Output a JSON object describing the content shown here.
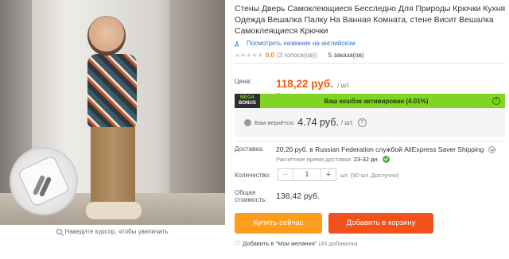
{
  "gallery": {
    "zoom_hint": "Наведите курсор, чтобы увеличить"
  },
  "product": {
    "title": "Стены Дверь Самоклеющиеся Бесследно Для Природы Крючки Кухня Одежда Вешалка Палку На Ванная Комната, стене Висит Вешалка Самоклеящиеся Крючки",
    "translate_link": "Посмотреть название на английском",
    "rating": {
      "stars": "★★★★★",
      "score": "0.0",
      "votes": "(3 голоса(ов))",
      "orders": "5 заказа(ов)"
    }
  },
  "pricing": {
    "price_label": "Цена:",
    "price": "118,22 руб.",
    "per_unit": "/ шт.",
    "wholesale": "Оптовая цена",
    "wholesale_arrow": "▾"
  },
  "cashback": {
    "badge_top": "MEGA",
    "badge_bottom": "BONUS",
    "text": "Ваш кешбэк активирован (4.01%)",
    "help": "?"
  },
  "return_info": {
    "label": "Вам вернётся:",
    "amount": "4.74 руб.",
    "per_unit": "/ шт.",
    "help": "?"
  },
  "shipping": {
    "label": "Доставка:",
    "amount": "20,20 руб.",
    "carrier": "в Russian Federation службой AliExpress Saver Shipping",
    "time_label": "Расчётное время доставки:",
    "time_value": "23-32 дн."
  },
  "quantity": {
    "label": "Количество:",
    "minus": "−",
    "value": "1",
    "plus": "+",
    "note": "шт. (90 шт. Доступно)"
  },
  "total": {
    "label_line1": "Общая",
    "label_line2": "стоимость:",
    "value": "138,42 руб."
  },
  "actions": {
    "buy_now": "Купить сейчас",
    "add_to_cart": "Добавить в корзину"
  },
  "wishlist": {
    "heart": "♡",
    "text": "Добавить в \"Мои желания\"",
    "count": "(45 добавили)"
  },
  "colors": {
    "price": "#f25a0c",
    "buy_button": "#ff9d1c",
    "cart_button": "#f1521b",
    "cashback_bar": "#80d424",
    "link": "#2d74c4"
  }
}
